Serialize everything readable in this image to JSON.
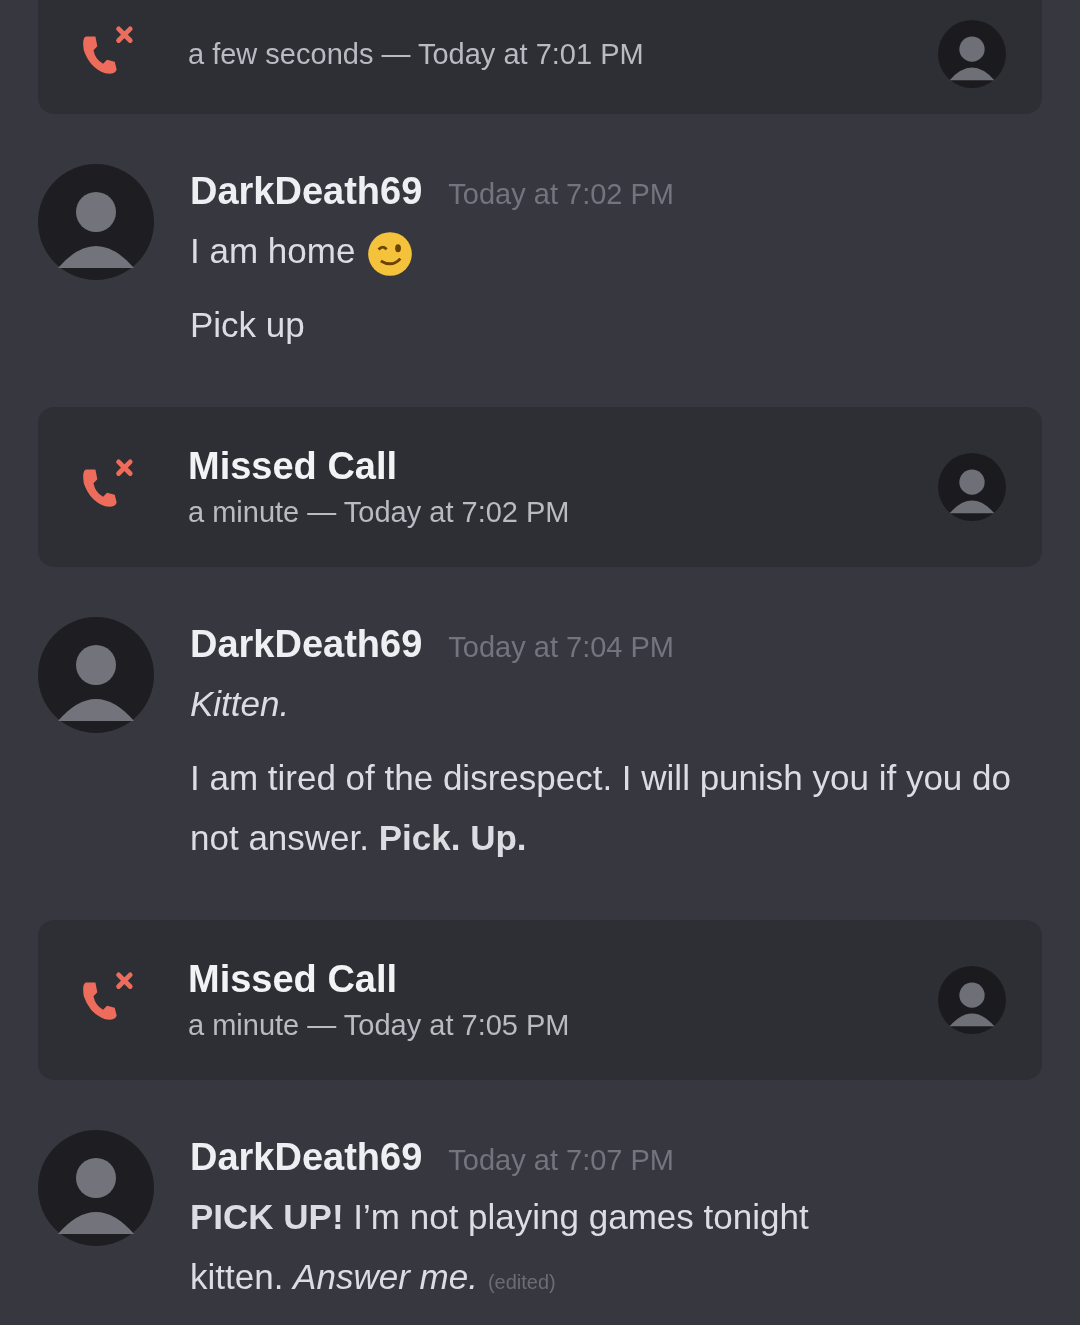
{
  "feed": [
    {
      "kind": "call",
      "cut": true,
      "duration": "a few seconds — Today at 7:01 PM"
    },
    {
      "kind": "message",
      "author": "DarkDeath69",
      "time": "Today at 7:02 PM",
      "lines": [
        {
          "text": "I am home",
          "italic": false,
          "emoji": true
        },
        {
          "text": "Pick up",
          "italic": false
        }
      ]
    },
    {
      "kind": "call",
      "cut": false,
      "title": "Missed Call",
      "duration": "a minute — Today at 7:02 PM"
    },
    {
      "kind": "message",
      "author": "DarkDeath69",
      "time": "Today at 7:04 PM",
      "lines": [
        {
          "text": "Kitten.",
          "italic": true
        },
        {
          "text": "I am tired of the disrespect. I will punish you if you do not answer. **Pick. Up.**",
          "italic": false
        }
      ]
    },
    {
      "kind": "call",
      "cut": false,
      "title": "Missed Call",
      "duration": "a minute — Today at 7:05 PM"
    },
    {
      "kind": "message",
      "author": "DarkDeath69",
      "time": "Today at 7:07 PM",
      "lines": [
        {
          "text": "**PICK UP!** I’m not playing games tonight",
          "italic": false
        },
        {
          "text": "kitten. *Answer me.*",
          "italic": false,
          "edited": "(edited)"
        }
      ]
    }
  ]
}
